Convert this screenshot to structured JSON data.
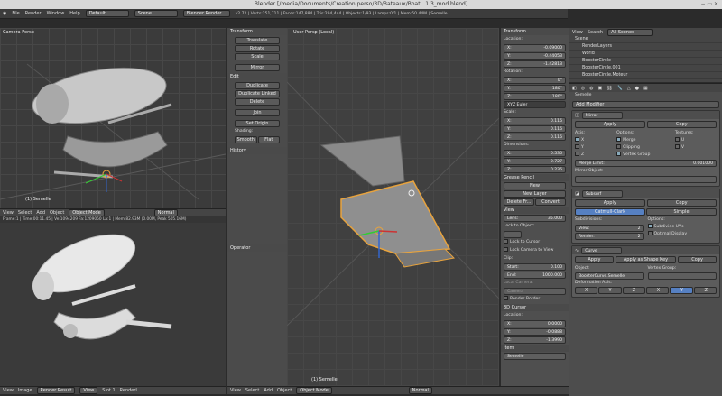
{
  "window": {
    "title": "Blender [/media/Documents/Creation perso/3D/Bateaux/Boat...1 3_mod.blend]",
    "controls": "− ▭ ✕"
  },
  "topbar": {
    "menus": [
      "File",
      "Render",
      "Window",
      "Help"
    ],
    "layout": "Default",
    "scene": "Scene",
    "engine": "Blender Render",
    "stats": "v2.72 | Verts:251,711 | Faces:147,884 | Tris:294,444 | Objects:1/93 | Lamps:0/1 | Mem:50.44M | Semelle"
  },
  "vp_topleft": {
    "label": "Camera Persp",
    "object": "(1) Semelle"
  },
  "vp_center": {
    "label": "User Persp (Local)",
    "object": "(1) Semelle"
  },
  "vp_header": {
    "view": "View",
    "select": "Select",
    "add": "Add",
    "object": "Object",
    "mode": "Object Mode",
    "shading": "Normal"
  },
  "render_status": "Frame:1 | Time:00:11.45 | Ve:1094209 Fa:1209050 La:1 | Mem:82.93M (0.00M, Peak 505.16M)",
  "image_header": {
    "view": "View",
    "image": "Image",
    "slot": "Render Result",
    "view2": "View",
    "slot_num": "Slot 1",
    "layer": "RenderL"
  },
  "toolshelf": {
    "transform_title": "Transform",
    "transform": [
      "Translate",
      "Rotate",
      "Scale"
    ],
    "mirror": "Mirror",
    "edit_title": "Edit",
    "edit": [
      "Duplicate",
      "Duplicate Linked",
      "Delete",
      "Join"
    ],
    "set_origin": "Set Origin",
    "shading_title": "Shading:",
    "smooth": "Smooth",
    "flat": "Flat",
    "history": "History",
    "operator": "Operator",
    "tabs": [
      "Tools",
      "Create",
      "Relations",
      "Animation",
      "Physics",
      "Grease Pencil"
    ]
  },
  "npanel": {
    "transform_title": "Transform",
    "location": "Location:",
    "loc": [
      {
        "a": "X:",
        "v": "-0.09000"
      },
      {
        "a": "Y:",
        "v": "-0.44053"
      },
      {
        "a": "Z:",
        "v": "-1.42813"
      }
    ],
    "rotation": "Rotation:",
    "rot": [
      {
        "a": "X:",
        "v": "0°"
      },
      {
        "a": "Y:",
        "v": "180°"
      },
      {
        "a": "Z:",
        "v": "180°"
      }
    ],
    "rot_mode": "XYZ Euler",
    "scale": "Scale:",
    "scl": [
      {
        "a": "X:",
        "v": "0.116"
      },
      {
        "a": "Y:",
        "v": "0.116"
      },
      {
        "a": "Z:",
        "v": "0.116"
      }
    ],
    "dimensions": "Dimensions:",
    "dim": [
      {
        "a": "X:",
        "v": "0.535"
      },
      {
        "a": "Y:",
        "v": "0.727"
      },
      {
        "a": "Z:",
        "v": "0.236"
      }
    ],
    "grease": "Grease Pencil",
    "gp_new": "New",
    "gp_layer": "New Layer",
    "gp_delete": "Delete Fr...",
    "gp_convert": "Convert",
    "view_title": "View",
    "lens": {
      "a": "Lens:",
      "v": "35.000"
    },
    "lock_obj": "Lock to Object:",
    "lock_cursor": "Lock to Cursor",
    "lock_cam": "Lock Camera to View",
    "clip": "Clip:",
    "start": {
      "a": "Start:",
      "v": "0.100"
    },
    "end": {
      "a": "End:",
      "v": "1000.000"
    },
    "local_cam": "Local Camera:",
    "camera": "Camera",
    "render_border": "Render Border",
    "cursor_title": "3D Cursor",
    "cursor_loc": "Location:",
    "cur": [
      {
        "a": "X:",
        "v": "0.0000"
      },
      {
        "a": "Y:",
        "v": "-0.0888"
      },
      {
        "a": "Z:",
        "v": "-1.3990"
      }
    ],
    "item_title": "Item",
    "item_name": "Semelle"
  },
  "outliner": {
    "view": "View",
    "search": "Search",
    "scope": "All Scenes",
    "items": [
      "Scene",
      "RenderLayers",
      "World",
      "BoosterCircle",
      "BoosterCircle.001",
      "BoosterCircle.Moteur"
    ]
  },
  "properties": {
    "object": "Semelle",
    "add_modifier": "Add Modifier",
    "mirror": {
      "name": "Mirror",
      "apply": "Apply",
      "copy": "Copy",
      "axis": "Axis:",
      "options": "Options:",
      "textures": "Textures:",
      "x": "X",
      "y": "Y",
      "z": "Z",
      "merge": "Merge",
      "clipping": "Clipping",
      "vgroup": "Vertex Group",
      "u": "U",
      "v": "V",
      "merge_limit": {
        "a": "Merge Limit:",
        "v": "0.001000"
      },
      "mirror_obj": "Mirror Object:"
    },
    "subsurf": {
      "name": "Subsurf",
      "apply": "Apply",
      "copy": "Copy",
      "catmull": "Catmull-Clark",
      "simple": "Simple",
      "subdiv": "Subdivisions:",
      "view": {
        "a": "View:",
        "v": "2"
      },
      "render": {
        "a": "Render:",
        "v": "2"
      },
      "options": "Options:",
      "uvs": "Subdivide UVs",
      "optimal": "Optimal Display"
    },
    "curve": {
      "name": "Curve",
      "apply": "Apply",
      "apply_shape": "Apply as Shape Key",
      "copy": "Copy",
      "object": "Object:",
      "vgroup": "Vertex Group:",
      "curve_obj": "BoosterCurve.Semelle",
      "deform": "Deformation Axis:",
      "axes": [
        "X",
        "Y",
        "Z",
        "-X",
        "-Y",
        "-Z"
      ]
    }
  },
  "colors": {
    "selection": "#e8a33d",
    "active_axis": "#5680c2"
  }
}
